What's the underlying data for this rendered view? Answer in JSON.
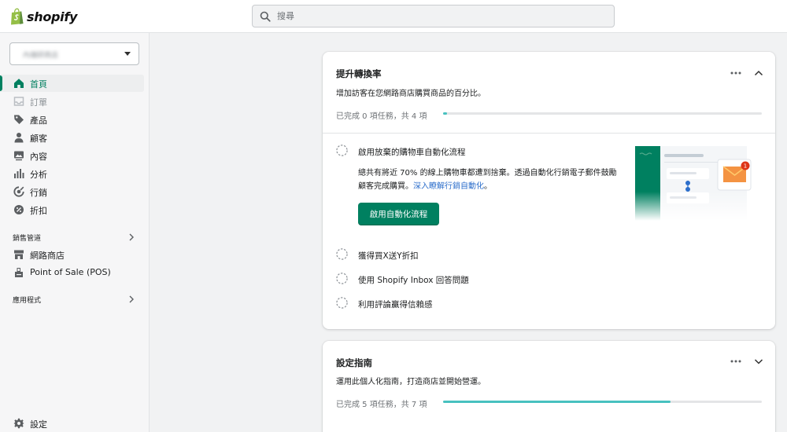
{
  "brand": {
    "logo_text": "shopify",
    "accent": "#008060",
    "progress_color": "#47c1bf",
    "link_color": "#2c6ecb"
  },
  "search": {
    "placeholder": "搜尋",
    "icon": "search-icon"
  },
  "sidebar": {
    "store_name": "內端研商店",
    "items": [
      {
        "label": "首頁",
        "icon": "home-icon",
        "active": true
      },
      {
        "label": "訂單",
        "icon": "inbox-icon",
        "disabled": true
      },
      {
        "label": "產品",
        "icon": "tag-icon"
      },
      {
        "label": "顧客",
        "icon": "person-icon"
      },
      {
        "label": "內容",
        "icon": "image-icon"
      },
      {
        "label": "分析",
        "icon": "bar-chart-icon"
      },
      {
        "label": "行銷",
        "icon": "target-icon"
      },
      {
        "label": "折扣",
        "icon": "discount-icon"
      }
    ],
    "sales_channels_label": "銷售管道",
    "channels": [
      {
        "label": "網路商店",
        "icon": "store-icon"
      },
      {
        "label": "Point of Sale (POS)",
        "icon": "pos-icon"
      }
    ],
    "apps_label": "應用程式",
    "settings_label": "設定"
  },
  "conversion_card": {
    "title": "提升轉換率",
    "subtitle": "增加訪客在您網路商店購買商品的百分比。",
    "progress_text": "已完成 0 項任務，共 4 項",
    "progress_fraction": 0.0,
    "tasks": [
      {
        "label": "啟用放棄的購物車自動化流程",
        "desc": "總共有將近 70% 的線上購物車都遭到捨棄。透過自動化行銷電子郵件鼓勵顧客完成購買。",
        "link": "深入瞭解行銷自動化",
        "link_suffix": "。",
        "button": "啟用自動化流程"
      },
      {
        "label": "獲得買X送Y折扣"
      },
      {
        "label": "使用 Shopify Inbox 回答問題"
      },
      {
        "label": "利用評論贏得信賴感"
      }
    ]
  },
  "setup_card": {
    "title": "設定指南",
    "subtitle": "運用此個人化指南，打造商店並開始營運。",
    "progress_text": "已完成 5 項任務，共 7 項",
    "progress_fraction": 0.714
  }
}
